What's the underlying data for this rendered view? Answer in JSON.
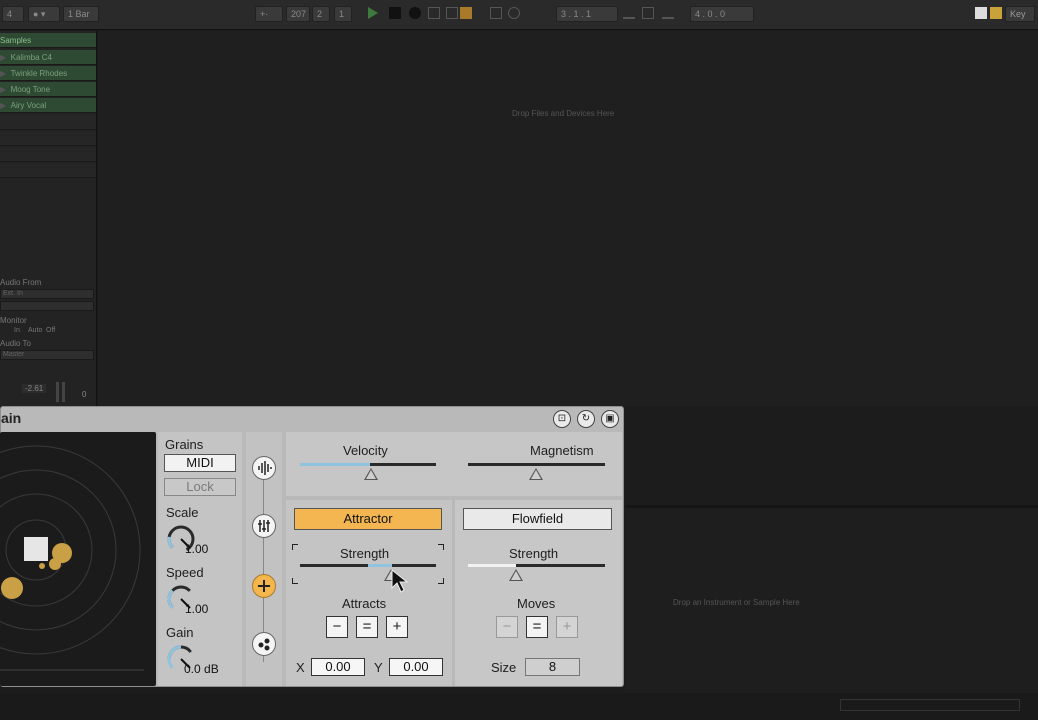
{
  "topbar": {
    "meter_value": "4",
    "quantize": "1 Bar",
    "tempo": "207",
    "tempo_frac": "2",
    "time_sig": "1",
    "position": "3 . 1 . 1",
    "loop_len": "4 . 0 . 0",
    "key_label": "Key"
  },
  "browser": {
    "category": "Samples",
    "clips": [
      "Kalimba C4",
      "Twinkle Rhodes",
      "Moog Tone",
      "Airy Vocal"
    ],
    "audio_from_label": "Audio From",
    "audio_from_value": "Ext. In",
    "monitor_label": "Monitor",
    "monitor_options": [
      "In",
      "Auto",
      "Off"
    ],
    "audio_to_label": "Audio To",
    "audio_to_value": "Master",
    "volume": "-2.61",
    "pan": "0"
  },
  "main": {
    "drop_hint": "Drop Files and Devices Here",
    "lower_drop_hint": "Drop an Instrument or Sample Here"
  },
  "device": {
    "title": "ain",
    "grains_label": "Grains",
    "midi_button": "MIDI",
    "lock_button": "Lock",
    "scale_label": "Scale",
    "scale_value": "1.00",
    "speed_label": "Speed",
    "speed_value": "1.00",
    "gain_label": "Gain",
    "gain_value": "0.0 dB",
    "velocity_label": "Velocity",
    "velocity_level": 0.5,
    "magnetism_label": "Magnetism",
    "magnetism_level": 0.5,
    "attractor_button": "Attractor",
    "flowfield_button": "Flowfield",
    "attr_strength_label": "Strength",
    "attr_strength_level": 0.55,
    "flow_strength_label": "Strength",
    "flow_strength_level": 0.35,
    "attracts_label": "Attracts",
    "moves_label": "Moves",
    "minus": "−",
    "equals": "=",
    "plus": "+",
    "x_label": "X",
    "x_value": "0.00",
    "y_label": "Y",
    "y_value": "0.00",
    "size_label": "Size",
    "size_value": "8",
    "accent_color": "#f2b64c",
    "slider_color": "#8fc3df"
  }
}
